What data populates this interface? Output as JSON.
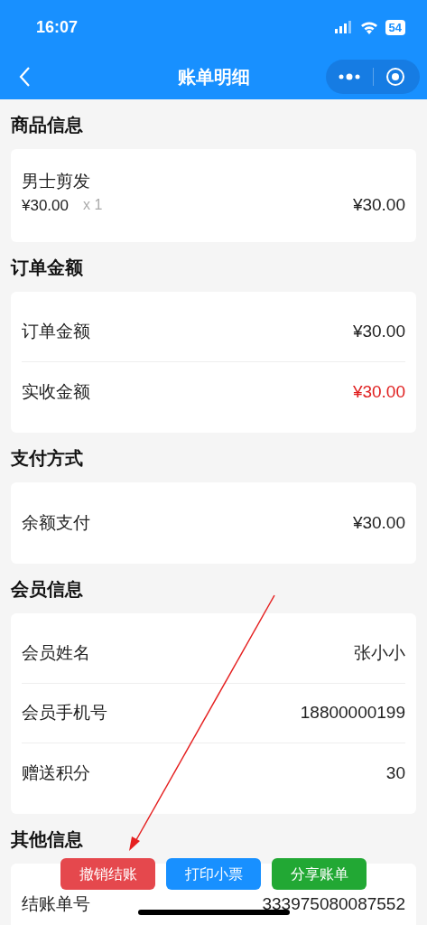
{
  "status_bar": {
    "time": "16:07",
    "battery": "54"
  },
  "nav": {
    "title": "账单明细"
  },
  "sections": [
    {
      "title": "商品信息",
      "kind": "products",
      "items": [
        {
          "name": "男士剪发",
          "price": "¥30.00",
          "quantity": "x 1",
          "total": "¥30.00"
        }
      ]
    },
    {
      "title": "订单金额",
      "kind": "rows",
      "rows": [
        {
          "label": "订单金额",
          "value": "¥30.00",
          "highlight": false
        },
        {
          "label": "实收金额",
          "value": "¥30.00",
          "highlight": true
        }
      ]
    },
    {
      "title": "支付方式",
      "kind": "rows",
      "rows": [
        {
          "label": "余额支付",
          "value": "¥30.00",
          "highlight": false
        }
      ]
    },
    {
      "title": "会员信息",
      "kind": "rows",
      "rows": [
        {
          "label": "会员姓名",
          "value": "张小小",
          "highlight": false
        },
        {
          "label": "会员手机号",
          "value": "18800000199",
          "highlight": false
        },
        {
          "label": "赠送积分",
          "value": "30",
          "highlight": false
        }
      ]
    },
    {
      "title": "其他信息",
      "kind": "rows",
      "rows": [
        {
          "label": "结账单号",
          "value": "333975080087552",
          "highlight": false
        }
      ]
    }
  ],
  "actions": [
    {
      "label": "撤销结账",
      "kind": "danger"
    },
    {
      "label": "打印小票",
      "kind": "primary"
    },
    {
      "label": "分享账单",
      "kind": "success"
    }
  ]
}
